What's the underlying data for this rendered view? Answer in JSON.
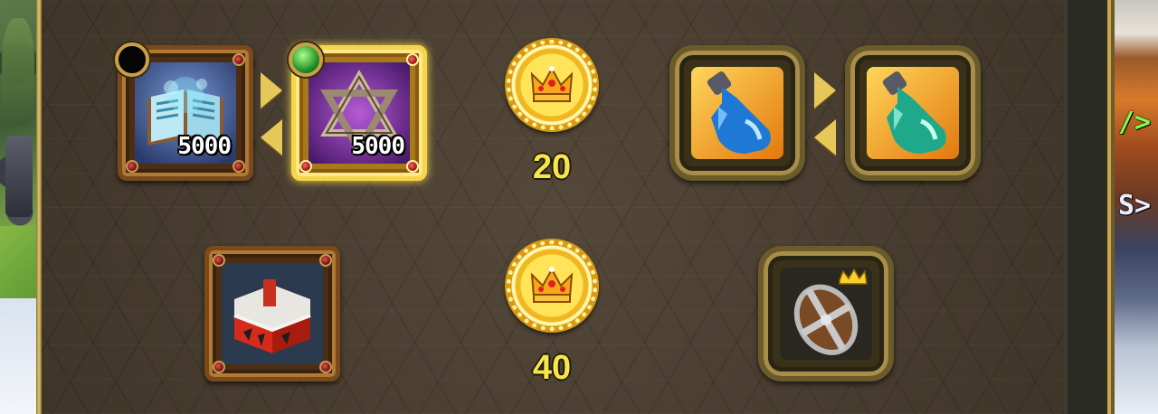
{
  "shop": {
    "row1": {
      "left_item": {
        "icon": "spellbook-icon",
        "quantity": "5000",
        "indicator": "empty"
      },
      "right_item": {
        "icon": "purple-star-emblem-icon",
        "quantity": "5000",
        "indicator": "green",
        "selected": true
      },
      "cost": {
        "icon": "crown-coin-icon",
        "amount": "20"
      },
      "potion_from": {
        "icon": "blue-potion-icon"
      },
      "potion_to": {
        "icon": "teal-potion-icon"
      }
    },
    "row2": {
      "left_item": {
        "icon": "supply-chest-icon"
      },
      "cost": {
        "icon": "crown-coin-icon",
        "amount": "40"
      },
      "right_item": {
        "icon": "crown-shield-icon"
      }
    }
  },
  "colors": {
    "cost_text": "#f7e64a",
    "selected_frame": "#f5d64a",
    "frame_wood": "#7a4a1c",
    "frame_bronze": "#6b5a2a"
  }
}
